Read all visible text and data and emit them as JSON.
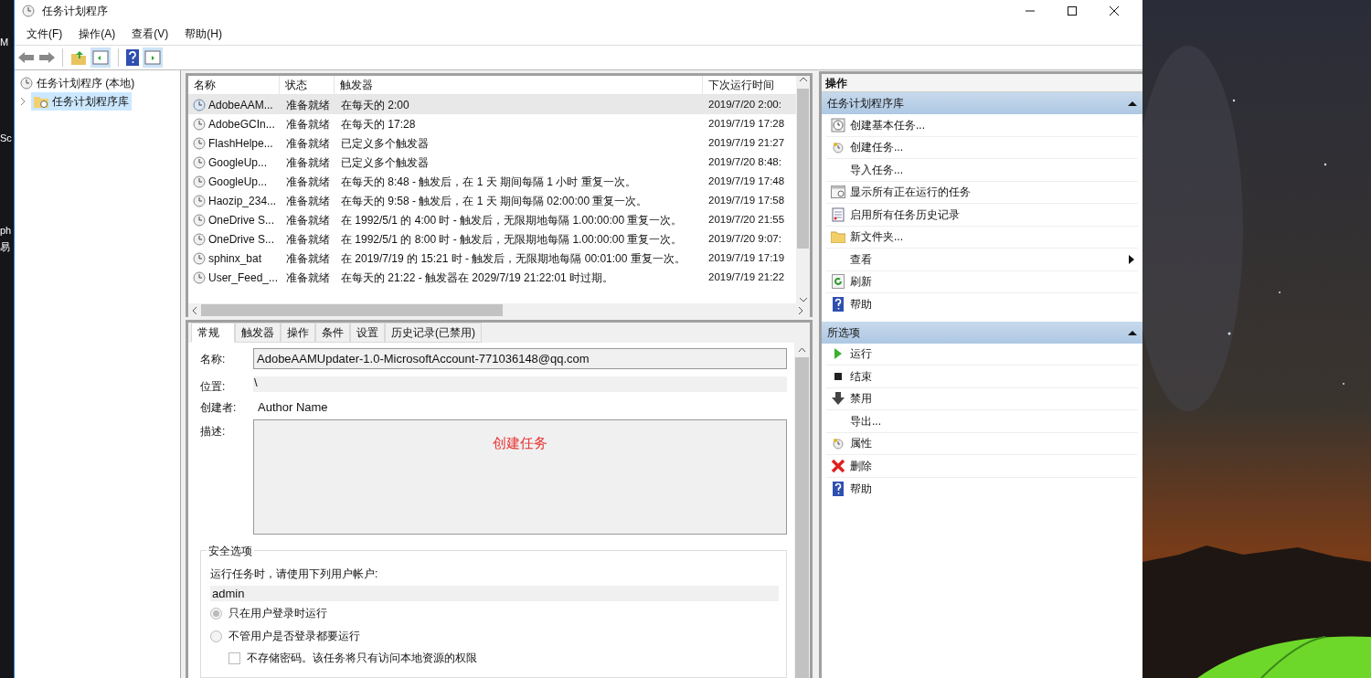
{
  "desktop_fragments": [
    "M",
    "Sc",
    "ph",
    "易"
  ],
  "window": {
    "title": "任务计划程序"
  },
  "menu": [
    "文件(F)",
    "操作(A)",
    "查看(V)",
    "帮助(H)"
  ],
  "tree": [
    {
      "label": "任务计划程序 (本地)",
      "selected": false,
      "children": [
        {
          "label": "任务计划程序库",
          "selected": true
        }
      ]
    }
  ],
  "table": {
    "columns": [
      "名称",
      "状态",
      "触发器",
      "下次运行时间"
    ],
    "rows": [
      {
        "name": "AdobeAAM...",
        "status": "准备就绪",
        "trigger": "在每天的 2:00",
        "next": "2019/7/20 2:00:",
        "selected": true
      },
      {
        "name": "AdobeGCIn...",
        "status": "准备就绪",
        "trigger": "在每天的 17:28",
        "next": "2019/7/19 17:28",
        "selected": false
      },
      {
        "name": "FlashHelpe...",
        "status": "准备就绪",
        "trigger": "已定义多个触发器",
        "next": "2019/7/19 21:27",
        "selected": false
      },
      {
        "name": "GoogleUp...",
        "status": "准备就绪",
        "trigger": "已定义多个触发器",
        "next": "2019/7/20 8:48:",
        "selected": false
      },
      {
        "name": "GoogleUp...",
        "status": "准备就绪",
        "trigger": "在每天的 8:48 - 触发后，在 1 天 期间每隔 1 小时 重复一次。",
        "next": "2019/7/19 17:48",
        "selected": false
      },
      {
        "name": "Haozip_234...",
        "status": "准备就绪",
        "trigger": "在每天的 9:58 - 触发后，在 1 天 期间每隔 02:00:00 重复一次。",
        "next": "2019/7/19 17:58",
        "selected": false
      },
      {
        "name": "OneDrive S...",
        "status": "准备就绪",
        "trigger": "在 1992/5/1 的 4:00 时 - 触发后，无限期地每隔 1.00:00:00 重复一次。",
        "next": "2019/7/20 21:55",
        "selected": false
      },
      {
        "name": "OneDrive S...",
        "status": "准备就绪",
        "trigger": "在 1992/5/1 的 8:00 时 - 触发后，无限期地每隔 1.00:00:00 重复一次。",
        "next": "2019/7/20 9:07:",
        "selected": false
      },
      {
        "name": "sphinx_bat",
        "status": "准备就绪",
        "trigger": "在 2019/7/19 的 15:21 时 - 触发后，无限期地每隔 00:01:00 重复一次。",
        "next": "2019/7/19 17:19",
        "selected": false
      },
      {
        "name": "User_Feed_...",
        "status": "准备就绪",
        "trigger": "在每天的 21:22 - 触发器在 2029/7/19 21:22:01 时过期。",
        "next": "2019/7/19 21:22",
        "selected": false
      }
    ]
  },
  "detail_tabs": [
    {
      "label": "常规",
      "selected": true
    },
    {
      "label": "触发器",
      "selected": false
    },
    {
      "label": "操作",
      "selected": false
    },
    {
      "label": "条件",
      "selected": false
    },
    {
      "label": "设置",
      "selected": false
    },
    {
      "label": "历史记录(已禁用)",
      "selected": false
    }
  ],
  "general": {
    "name_label": "名称:",
    "name_value": "AdobeAAMUpdater-1.0-MicrosoftAccount-771036148@qq.com",
    "location_label": "位置:",
    "location_value": "\\",
    "author_label": "创建者:",
    "author_value": "Author Name",
    "description_label": "描述:",
    "description_value": "创建任务",
    "security": {
      "title": "安全选项",
      "account_label": "运行任务时，请使用下列用户帐户:",
      "account_value": "admin",
      "options": [
        {
          "kind": "radio",
          "label": "只在用户登录时运行",
          "checked": true
        },
        {
          "kind": "radio",
          "label": "不管用户是否登录都要运行",
          "checked": false
        },
        {
          "kind": "checkbox",
          "label": "不存储密码。该任务将只有访问本地资源的权限",
          "checked": false
        }
      ]
    }
  },
  "actions": {
    "title": "操作",
    "sections": [
      {
        "title": "任务计划程序库",
        "expanded": true,
        "items": [
          {
            "label": "创建基本任务...",
            "kind": "command"
          },
          {
            "label": "创建任务...",
            "kind": "command"
          },
          {
            "label": "导入任务...",
            "kind": "command"
          },
          {
            "label": "显示所有正在运行的任务",
            "kind": "command"
          },
          {
            "label": "启用所有任务历史记录",
            "kind": "command"
          },
          {
            "label": "新文件夹...",
            "kind": "command"
          },
          {
            "label": "查看",
            "kind": "submenu"
          },
          {
            "label": "刷新",
            "kind": "command"
          },
          {
            "label": "帮助",
            "kind": "command"
          }
        ]
      },
      {
        "title": "所选项",
        "expanded": true,
        "items": [
          {
            "label": "运行",
            "kind": "command"
          },
          {
            "label": "结束",
            "kind": "command"
          },
          {
            "label": "禁用",
            "kind": "command"
          },
          {
            "label": "导出...",
            "kind": "command"
          },
          {
            "label": "属性",
            "kind": "command"
          },
          {
            "label": "删除",
            "kind": "command"
          },
          {
            "label": "帮助",
            "kind": "command"
          }
        ]
      }
    ]
  }
}
